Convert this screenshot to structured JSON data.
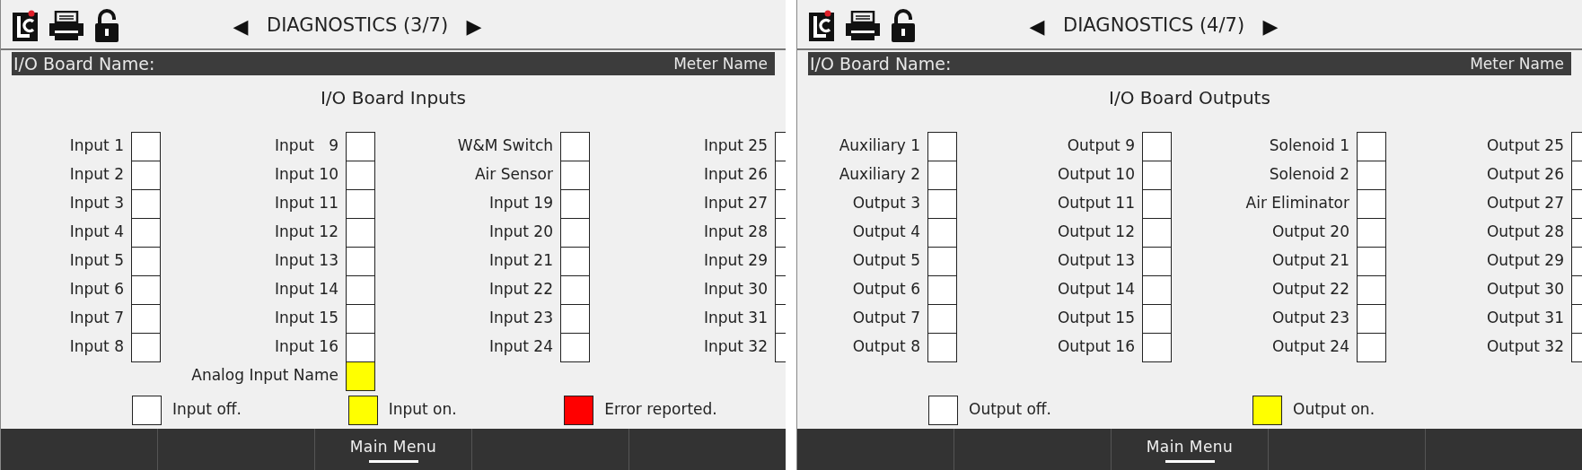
{
  "panels": [
    {
      "prev": "◀",
      "title": "DIAGNOSTICS (3/7)",
      "next": "▶",
      "board_label": "I/O Board Name:",
      "meter_name": "Meter Name",
      "section_title": "I/O Board Inputs",
      "columns": [
        [
          {
            "label": "Input 1",
            "on": false
          },
          {
            "label": "Input 2",
            "on": false
          },
          {
            "label": "Input 3",
            "on": false
          },
          {
            "label": "Input 4",
            "on": false
          },
          {
            "label": "Input 5",
            "on": false
          },
          {
            "label": "Input 6",
            "on": false
          },
          {
            "label": "Input 7",
            "on": false
          },
          {
            "label": "Input 8",
            "on": false
          }
        ],
        [
          {
            "label": "Input   9",
            "on": false
          },
          {
            "label": "Input 10",
            "on": false
          },
          {
            "label": "Input 11",
            "on": false
          },
          {
            "label": "Input 12",
            "on": false
          },
          {
            "label": "Input 13",
            "on": false
          },
          {
            "label": "Input 14",
            "on": false
          },
          {
            "label": "Input 15",
            "on": false
          },
          {
            "label": "Input 16",
            "on": false
          },
          {
            "label": "Analog Input Name",
            "on": true
          }
        ],
        [
          {
            "label": "W&M Switch",
            "on": false
          },
          {
            "label": "Air Sensor",
            "on": false
          },
          {
            "label": "Input 19",
            "on": false
          },
          {
            "label": "Input 20",
            "on": false
          },
          {
            "label": "Input 21",
            "on": false
          },
          {
            "label": "Input 22",
            "on": false
          },
          {
            "label": "Input 23",
            "on": false
          },
          {
            "label": "Input 24",
            "on": false
          }
        ],
        [
          {
            "label": "Input 25",
            "on": false
          },
          {
            "label": "Input 26",
            "on": false
          },
          {
            "label": "Input 27",
            "on": false
          },
          {
            "label": "Input 28",
            "on": false
          },
          {
            "label": "Input 29",
            "on": false
          },
          {
            "label": "Input 30",
            "on": false
          },
          {
            "label": "Input 31",
            "on": false
          },
          {
            "label": "Input 32",
            "on": false
          }
        ]
      ],
      "legend": [
        {
          "label": "Input off.",
          "on": false,
          "error": false
        },
        {
          "label": "Input on.",
          "on": true,
          "error": false
        },
        {
          "label": "Error reported.",
          "error": true
        }
      ],
      "footer": [
        {
          "label": "Main Menu",
          "selected": true
        }
      ]
    },
    {
      "prev": "◀",
      "title": "DIAGNOSTICS (4/7)",
      "next": "▶",
      "board_label": "I/O Board Name:",
      "meter_name": "Meter Name",
      "section_title": "I/O Board Outputs",
      "columns": [
        [
          {
            "label": "Auxiliary 1",
            "on": false
          },
          {
            "label": "Auxiliary 2",
            "on": false
          },
          {
            "label": "Output 3",
            "on": false
          },
          {
            "label": "Output 4",
            "on": false
          },
          {
            "label": "Output 5",
            "on": false
          },
          {
            "label": "Output 6",
            "on": false
          },
          {
            "label": "Output 7",
            "on": false
          },
          {
            "label": "Output 8",
            "on": false
          }
        ],
        [
          {
            "label": "Output 9",
            "on": false
          },
          {
            "label": "Output 10",
            "on": false
          },
          {
            "label": "Output 11",
            "on": false
          },
          {
            "label": "Output 12",
            "on": false
          },
          {
            "label": "Output 13",
            "on": false
          },
          {
            "label": "Output 14",
            "on": false
          },
          {
            "label": "Output 15",
            "on": false
          },
          {
            "label": "Output 16",
            "on": false
          }
        ],
        [
          {
            "label": "Solenoid 1",
            "on": false
          },
          {
            "label": "Solenoid 2",
            "on": false
          },
          {
            "label": "Air Eliminator",
            "on": false
          },
          {
            "label": "Output 20",
            "on": false
          },
          {
            "label": "Output 21",
            "on": false
          },
          {
            "label": "Output 22",
            "on": false
          },
          {
            "label": "Output 23",
            "on": false
          },
          {
            "label": "Output 24",
            "on": false
          }
        ],
        [
          {
            "label": "Output 25",
            "on": false
          },
          {
            "label": "Output 26",
            "on": false
          },
          {
            "label": "Output 27",
            "on": false
          },
          {
            "label": "Output 28",
            "on": false
          },
          {
            "label": "Output 29",
            "on": false
          },
          {
            "label": "Output 30",
            "on": false
          },
          {
            "label": "Output 31",
            "on": false
          },
          {
            "label": "Output 32",
            "on": false
          }
        ]
      ],
      "legend": [
        {
          "label": "Output off.",
          "on": false,
          "error": false
        },
        {
          "label": "Output on.",
          "on": true,
          "error": false
        }
      ],
      "footer": [
        {
          "label": "Main Menu",
          "selected": true
        }
      ]
    }
  ]
}
